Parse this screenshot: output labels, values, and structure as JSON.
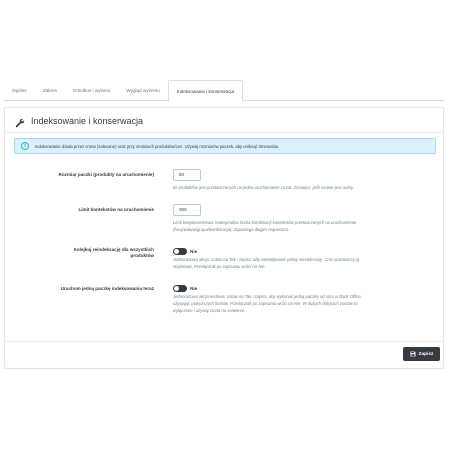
{
  "tabs": [
    {
      "label": "Ogólne"
    },
    {
      "label": "Zakres"
    },
    {
      "label": "Omnibus i wyłomo"
    },
    {
      "label": "Wygląd wykresu"
    },
    {
      "label": "Indeksowanie i konserwacja"
    }
  ],
  "panel": {
    "title": "Indeksowanie i konserwacja",
    "icon": "wrench-icon"
  },
  "alert": {
    "text": "Indeksowanie działa przez crona (zalecane) oraz przy zmianach produktów/cen. Używaj rozmiarów paczek, aby uniknąć timeoutów."
  },
  "fields": {
    "batch": {
      "label": "Rozmiar paczki (produkty na uruchomienie)",
      "value": "50",
      "help": "Ile produktów jest przetwarzanych na jedno uruchomienie crona. Zmniejsz, jeśli serwer jest wolny."
    },
    "combo": {
      "label": "Limit kontekstów na uruchomienie",
      "value": "300",
      "help1": "Limit bezpieczeństwa: maksymalna liczba kombinacji kontekstów przetwarzanych na uruchomienie",
      "help2": "(hrsą/waluta/grupa/kombinacja). Zapobiega długim requestom."
    },
    "queue": {
      "label1": "Kolejkuj reindeksację dla wszystkich",
      "label2": "produktów",
      "state": "Nie",
      "help1": "Jednorazowa akcja: ustaw na Tak i zapisz, aby zakolejkować pełną reindeksację. Cron przetworzy ją",
      "help2": "stopniowo. Przełącznik po zapisaniu wróci na Nie."
    },
    "run_now": {
      "label": "Uruchom jedną paczkę indeksowania teraz",
      "state": "Nie",
      "help1": "Jednorazowa akcja testowa: ustaw na Tak i zapisz, aby wykonać jedną paczkę od razu w Back Office,",
      "help2": "używając powyższych limitów. Przełącznik po zapisaniu wróci na Nie. W dużych sklepach zostaw to",
      "help3": "wyłączone i używaj crona na serwerze."
    }
  },
  "save_label": "Zapisz",
  "colors": {
    "accent": "#25b9d7",
    "dark": "#363a41",
    "alert_bg": "#dcf2fb"
  }
}
